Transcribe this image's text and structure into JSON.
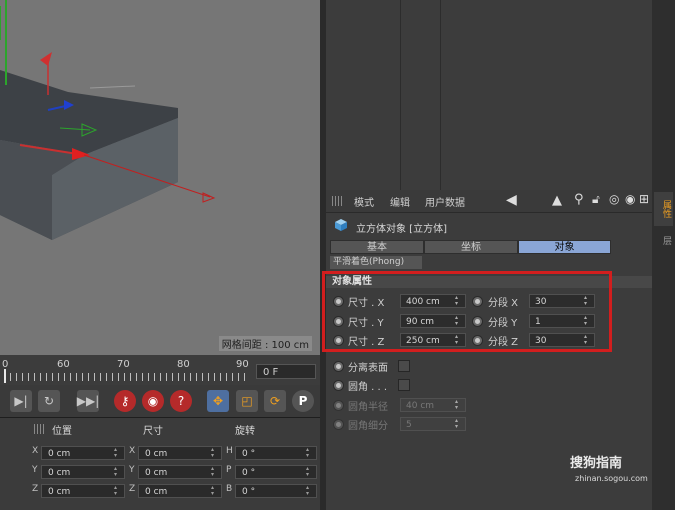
{
  "viewport": {
    "grid_spacing": "网格间距 : 100 cm"
  },
  "timeline": {
    "ticks": [
      "0",
      "60",
      "70",
      "80",
      "90"
    ],
    "current_frame": "0 F"
  },
  "coords": {
    "headers": [
      "位置",
      "尺寸",
      "旋转"
    ],
    "rows": [
      {
        "pos_axis": "X",
        "pos": "0 cm",
        "size_axis": "X",
        "size": "0 cm",
        "rot_axis": "H",
        "rot": "0 °"
      },
      {
        "pos_axis": "Y",
        "pos": "0 cm",
        "size_axis": "Y",
        "size": "0 cm",
        "rot_axis": "P",
        "rot": "0 °"
      },
      {
        "pos_axis": "Z",
        "pos": "0 cm",
        "size_axis": "Z",
        "size": "0 cm",
        "rot_axis": "B",
        "rot": "0 °"
      }
    ]
  },
  "attr": {
    "menu": [
      "模式",
      "编辑",
      "用户数据"
    ],
    "object_title": "立方体对象 [立方体]",
    "tabs": [
      "基本",
      "坐标",
      "对象"
    ],
    "active_tab": "对象",
    "phong_tab": "平滑着色(Phong)",
    "section": "对象属性",
    "size_rows": [
      {
        "label": "尺寸 . X",
        "value": "400 cm",
        "seg_label": "分段 X",
        "seg_value": "30"
      },
      {
        "label": "尺寸 . Y",
        "value": "90 cm",
        "seg_label": "分段 Y",
        "seg_value": "1"
      },
      {
        "label": "尺寸 . Z",
        "value": "250 cm",
        "seg_label": "分段 Z",
        "seg_value": "30"
      }
    ],
    "separate_surfaces": "分离表面",
    "fillet": "圆角 . . .",
    "fillet_radius_label": "圆角半径",
    "fillet_radius": "40 cm",
    "fillet_subdiv_label": "圆角细分",
    "fillet_subdiv": "5"
  },
  "sidestrip": {
    "tab_attr": "属性",
    "tab_layer": "层"
  },
  "watermark": {
    "brand": "搜狗指南",
    "url": "zhinan.sogou.com"
  },
  "colors": {
    "accent_tab": "#8aa6d6",
    "highlight": "#d21e1e"
  }
}
